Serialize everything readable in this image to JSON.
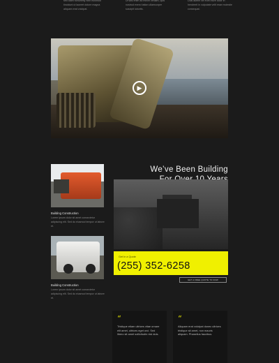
{
  "top_columns": [
    {
      "text": "sed diam nonummy nibh euismod tincidunt ut laoreet dolore magna aliquam erat volutpat."
    },
    {
      "text": "Ut wisi enim ad minim veniam, quis nostrud exerci tation ullamcorper suscipit lobortis."
    },
    {
      "text": "Duis autem vel eum iriure dolor in hendrerit in vulputate velit esse molestie consequat."
    }
  ],
  "hero_video": {
    "play_icon": "play-icon"
  },
  "cards": [
    {
      "title": "Building Construction",
      "text": "Lorem ipsum dolor sit amet consectetur adipiscing elit. Sed do eiusmod tempor ut labore et."
    },
    {
      "title": "Building Construction",
      "text": "Lorem ipsum dolor sit amet consectetur adipiscing elit. Sed do eiusmod tempor ut labore et."
    }
  ],
  "about": {
    "heading_line1": "We’ve Been Building",
    "heading_line2": "For Over 10 Years"
  },
  "call": {
    "label": "Get In a Quote",
    "phone": "(255) 352-6258",
    "button": "GET A FREE QUOTE TO NOW"
  },
  "testimonials": [
    {
      "quote_mark": "“",
      "text": "Tristique etiam ultrices vitae ornare elit amet, ultrices eget orci. Sed libero sit amet sollicitudin nisl duis."
    },
    {
      "quote_mark": "“",
      "text": "Aliquam erat volutpat donec ultrices tristique sit amet, non mauris aliquam. Phasellus faucibus."
    }
  ],
  "colors": {
    "background": "#1b1b1b",
    "accent": "#f0f000",
    "text": "#cfcfcf"
  }
}
